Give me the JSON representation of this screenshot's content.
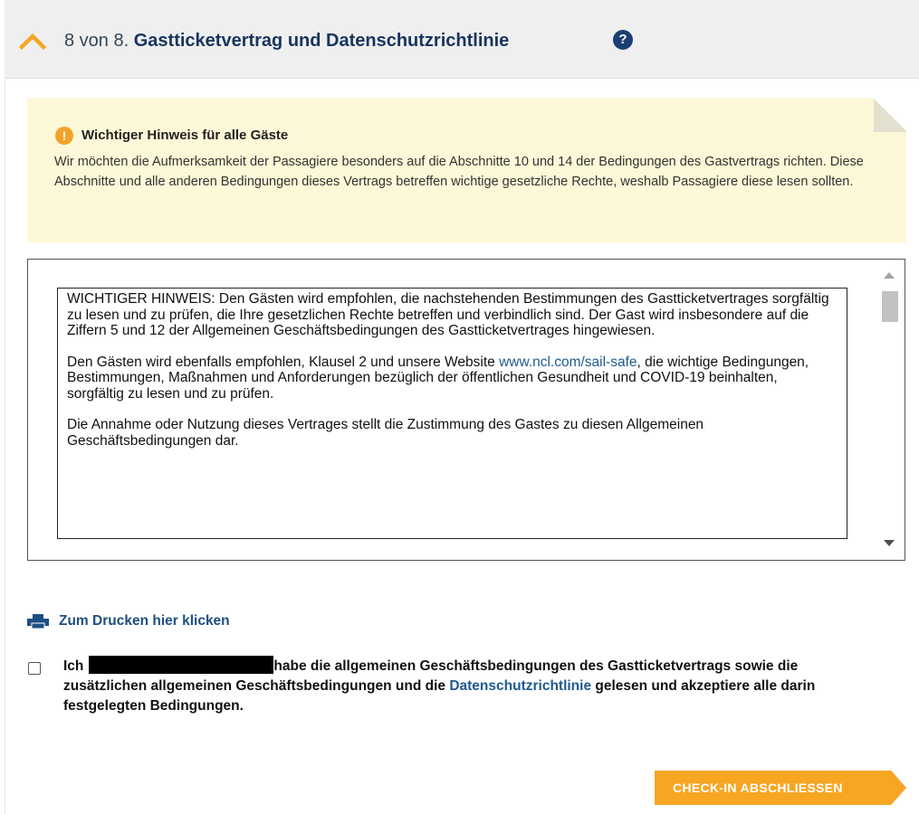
{
  "header": {
    "step": "8 von 8.",
    "title": "Gastticketvertrag und Datenschutzrichtlinie",
    "help_glyph": "?",
    "chevron_icon": "chevron-up-icon",
    "accent_color": "#f6a623"
  },
  "notice": {
    "icon": "info-icon",
    "icon_glyph": "!",
    "title": "Wichtiger Hinweis für alle Gäste",
    "body": "Wir möchten die Aufmerksamkeit der Passagiere besonders auf die Abschnitte 10 und 14 der Bedingungen des Gastvertrags richten. Diese Abschnitte und alle anderen Bedingungen dieses Vertrags betreffen wichtige gesetzliche Rechte, weshalb Passagiere diese lesen sollten."
  },
  "terms": {
    "p1": "WICHTIGER HINWEIS: Den Gästen wird empfohlen, die nachstehenden Bestimmungen des Gastticketvertrages sorgfältig zu lesen und zu prüfen, die Ihre gesetzlichen Rechte betreffen und verbindlich sind. Der Gast wird insbesondere auf die Ziffern 5 und 12 der Allgemeinen Geschäftsbedingungen des Gastticketvertrages hingewiesen.",
    "p2_before": "Den Gästen wird ebenfalls empfohlen, Klausel 2 und unsere Website ",
    "p2_link": "www.ncl.com/sail-safe",
    "p2_after": ", die wichtige Bedingungen, Bestimmungen, Maßnahmen und Anforderungen bezüglich der öffentlichen Gesundheit und COVID-19 beinhalten, sorgfältig zu lesen und zu prüfen.",
    "p3": "Die Annahme oder Nutzung dieses Vertrages stellt die Zustimmung des Gastes zu diesen Allgemeinen Geschäftsbedingungen dar."
  },
  "print": {
    "icon": "printer-icon",
    "label": "Zum Drucken hier klicken"
  },
  "consent": {
    "prefix": "Ich",
    "middle": "habe die allgemeinen Geschäftsbedingungen des Gastticketvertrags sowie die zusätzlichen allgemeinen Geschäftsbedingungen und die ",
    "link": "Datenschutzrichtlinie",
    "suffix": " gelesen und akzeptiere alle darin festgelegten Bedingungen.",
    "checked": false
  },
  "actions": {
    "checkin_label": "CHECK-IN ABSCHLIESSEN"
  }
}
